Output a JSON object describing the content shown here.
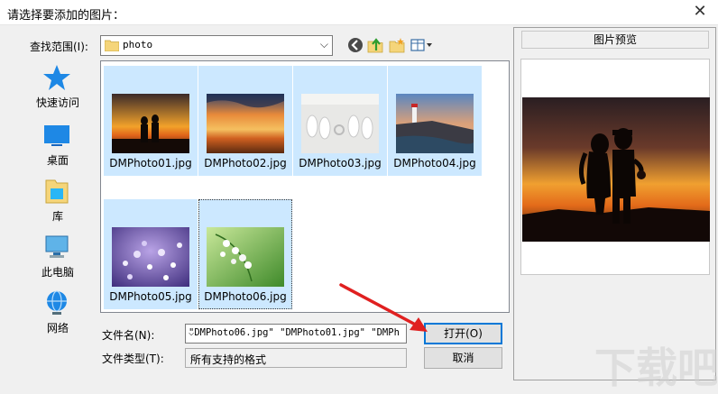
{
  "window": {
    "title": "请选择要添加的图片："
  },
  "lookin": {
    "label": "查找范围(I):",
    "value": "photo"
  },
  "places": [
    {
      "label": "快速访问",
      "icon": "star-pin-icon"
    },
    {
      "label": "桌面",
      "icon": "desktop-icon"
    },
    {
      "label": "库",
      "icon": "library-icon"
    },
    {
      "label": "此电脑",
      "icon": "computer-icon"
    },
    {
      "label": "网络",
      "icon": "network-icon"
    }
  ],
  "files": [
    {
      "name": "DMPhoto01.jpg"
    },
    {
      "name": "DMPhoto02.jpg"
    },
    {
      "name": "DMPhoto03.jpg"
    },
    {
      "name": "DMPhoto04.jpg"
    },
    {
      "name": "DMPhoto05.jpg"
    },
    {
      "name": "DMPhoto06.jpg"
    }
  ],
  "filename": {
    "label": "文件名(N):",
    "value": "\"DMPhoto06.jpg\" \"DMPhoto01.jpg\" \"DMPh"
  },
  "filetype": {
    "label": "文件类型(T):",
    "value": "所有支持的格式"
  },
  "buttons": {
    "open": "打开(O)",
    "cancel": "取消"
  },
  "preview": {
    "title": "图片预览"
  },
  "colors": {
    "selection": "#cce8ff",
    "accent": "#0078d7",
    "arrow": "#e02020"
  }
}
